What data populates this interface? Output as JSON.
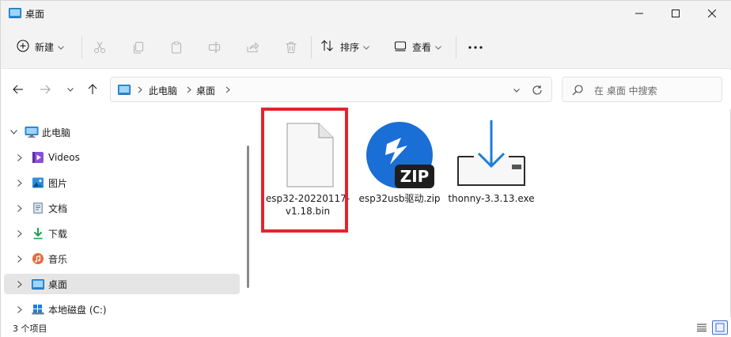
{
  "window": {
    "title": "桌面"
  },
  "toolbar": {
    "new_label": "新建",
    "sort_label": "排序",
    "view_label": "查看",
    "icons": [
      "cut-icon",
      "copy-icon",
      "paste-icon",
      "rename-icon",
      "share-icon",
      "delete-icon"
    ]
  },
  "address": {
    "crumbs": [
      "此电脑",
      "桌面"
    ]
  },
  "search": {
    "placeholder": "在 桌面 中搜索"
  },
  "sidebar": {
    "items": [
      {
        "label": "此电脑",
        "icon": "computer-icon"
      },
      {
        "label": "Videos",
        "icon": "videos-icon"
      },
      {
        "label": "图片",
        "icon": "pictures-icon"
      },
      {
        "label": "文档",
        "icon": "documents-icon"
      },
      {
        "label": "下载",
        "icon": "downloads-icon"
      },
      {
        "label": "音乐",
        "icon": "music-icon"
      },
      {
        "label": "桌面",
        "icon": "desktop-icon",
        "selected": true
      },
      {
        "label": "本地磁盘 (C:)",
        "icon": "drive-icon"
      }
    ]
  },
  "files": [
    {
      "name": "esp32-20220117-v1.18.bin",
      "icon": "generic-file-icon",
      "highlighted": true
    },
    {
      "name": "esp32usb驱动.zip",
      "icon": "zip-archive-icon"
    },
    {
      "name": "thonny-3.3.13.exe",
      "icon": "installer-icon"
    }
  ],
  "status": {
    "item_count": "3 个项目"
  },
  "colors": {
    "highlight_border": "#e0262c",
    "accent": "#1a6fd6",
    "selection_bg": "#e5e5e5"
  }
}
